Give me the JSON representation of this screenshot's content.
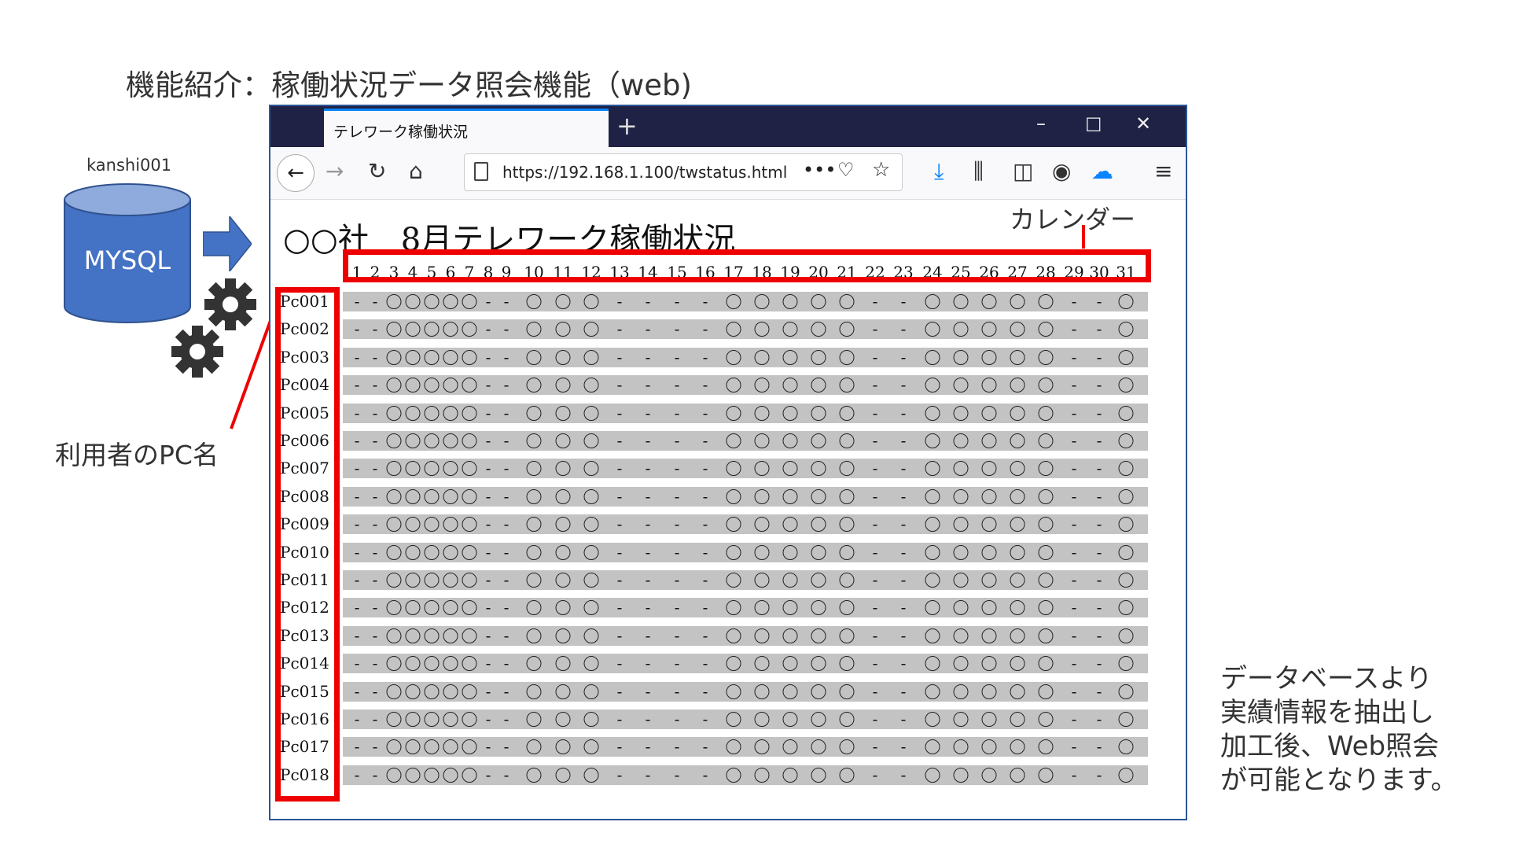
{
  "slide": {
    "title": "機能紹介：稼働状況データ照会機能（web)",
    "db_label": "kanshi001",
    "db_name": "MYSQL",
    "pc_label": "利用者のPC名",
    "note_lines": [
      "データベースより",
      "実績情報を抽出し",
      "加工後、Web照会",
      "が可能となります。"
    ],
    "colors": {
      "accent_red": "#ee0000",
      "db_blue": "#4472c4",
      "arrow_blue": "#4472c4"
    }
  },
  "browser": {
    "tab_title": "テレワーク稼働状況",
    "url": "https://192.168.1.100/twstatus.html",
    "icons": [
      "back-icon",
      "forward-icon",
      "reload-icon",
      "home-icon",
      "more-icon",
      "pocket-icon",
      "star-icon",
      "download-icon",
      "library-icon",
      "sidebar-icon",
      "account-icon",
      "cloud-icon",
      "menu-icon"
    ]
  },
  "page": {
    "heading": "○○社　8月テレワーク稼働状況",
    "calendar_annotation": "カレンダー",
    "days": [
      "1",
      "2",
      "3",
      "4",
      "5",
      "6",
      "7",
      "8",
      "9",
      "10",
      "11",
      "12",
      "13",
      "14",
      "15",
      "16",
      "17",
      "18",
      "19",
      "20",
      "21",
      "22",
      "23",
      "24",
      "25",
      "26",
      "27",
      "28",
      "29",
      "30",
      "31"
    ],
    "rows": [
      {
        "pc": "Pc001"
      },
      {
        "pc": "Pc002"
      },
      {
        "pc": "Pc003"
      },
      {
        "pc": "Pc004"
      },
      {
        "pc": "Pc005"
      },
      {
        "pc": "Pc006"
      },
      {
        "pc": "Pc007"
      },
      {
        "pc": "Pc008"
      },
      {
        "pc": "Pc009"
      },
      {
        "pc": "Pc010"
      },
      {
        "pc": "Pc011"
      },
      {
        "pc": "Pc012"
      },
      {
        "pc": "Pc013"
      },
      {
        "pc": "Pc014"
      },
      {
        "pc": "Pc015"
      },
      {
        "pc": "Pc016"
      },
      {
        "pc": "Pc017"
      },
      {
        "pc": "Pc018"
      }
    ],
    "status_pattern": [
      "-",
      "-",
      "○",
      "○",
      "○",
      "○",
      "○",
      "-",
      "-",
      "○",
      "○",
      "○",
      "-",
      "-",
      "-",
      "-",
      "○",
      "○",
      "○",
      "○",
      "○",
      "-",
      "-",
      "○",
      "○",
      "○",
      "○",
      "○",
      "-",
      "-",
      "○"
    ]
  }
}
